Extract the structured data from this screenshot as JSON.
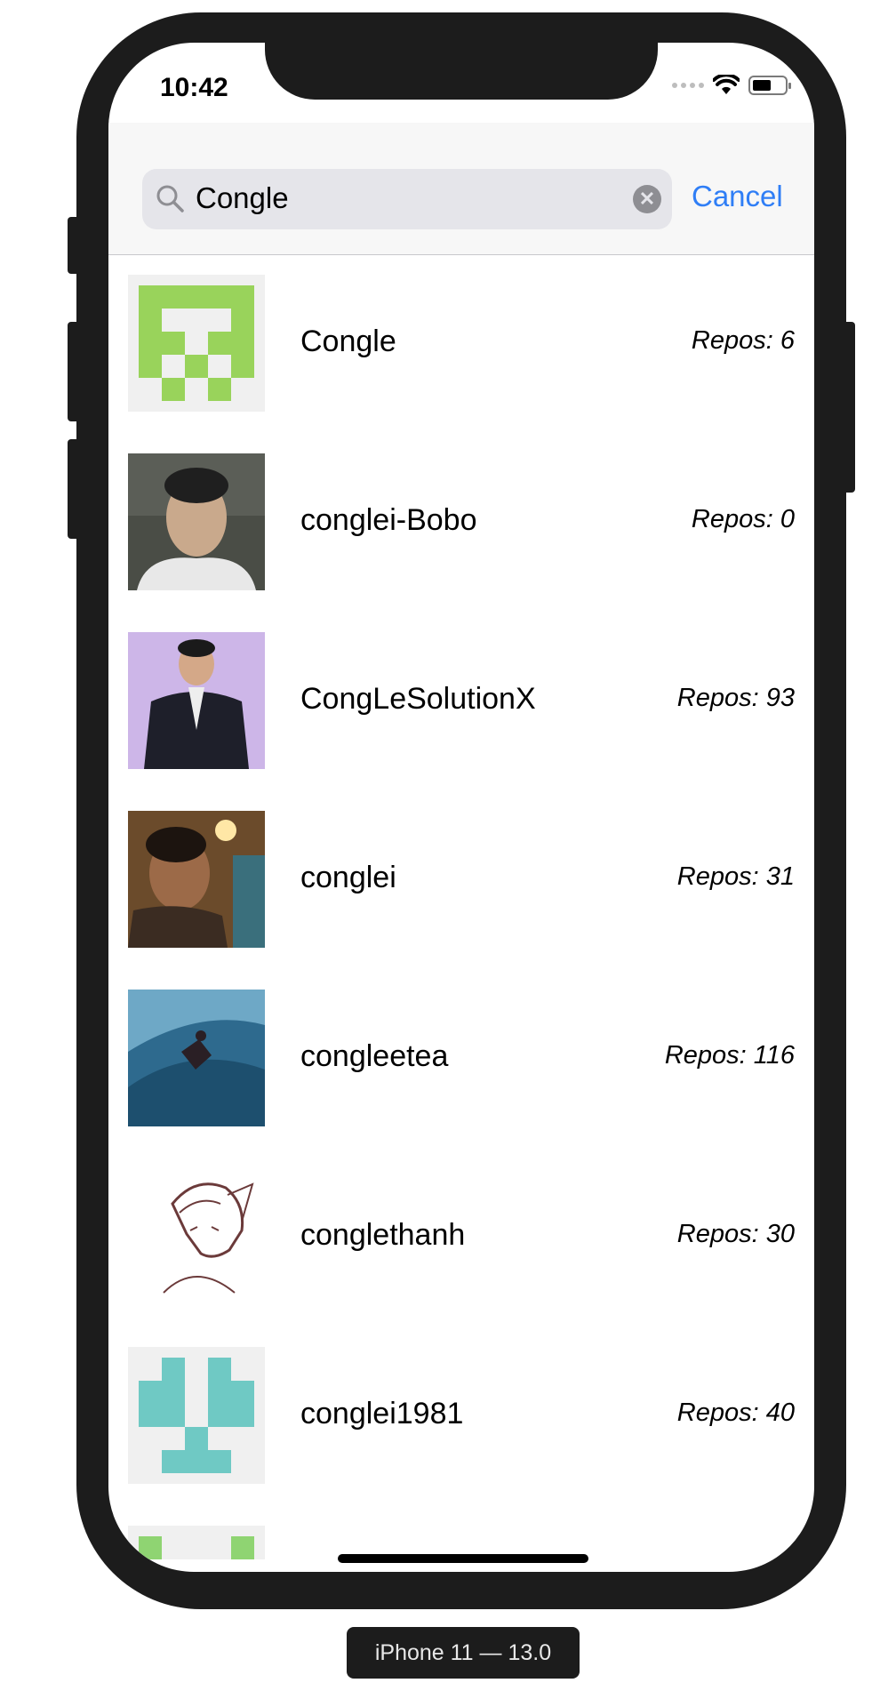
{
  "status_bar": {
    "time": "10:42"
  },
  "search": {
    "query": "Congle",
    "cancel_label": "Cancel"
  },
  "results": [
    {
      "name": "Congle",
      "repos": "Repos: 6",
      "avatar": "identicon-green-avatar"
    },
    {
      "name": "conglei-Bobo",
      "repos": "Repos: 0",
      "avatar": "photo-avatar"
    },
    {
      "name": "CongLeSolutionX",
      "repos": "Repos: 93",
      "avatar": "photo-avatar-suit"
    },
    {
      "name": "conglei",
      "repos": "Repos: 31",
      "avatar": "photo-avatar-street"
    },
    {
      "name": "congleetea",
      "repos": "Repos: 116",
      "avatar": "photo-avatar-surfer"
    },
    {
      "name": "conglethanh",
      "repos": "Repos: 30",
      "avatar": "sketch-avatar"
    },
    {
      "name": "conglei1981",
      "repos": "Repos: 40",
      "avatar": "identicon-teal-avatar"
    }
  ],
  "device_label": "iPhone 11 — 13.0",
  "colors": {
    "accent": "#2f7ef6",
    "device_frame": "#1c1c1c",
    "identicon_green": "#99d35b",
    "identicon_teal": "#6fc9c4"
  }
}
